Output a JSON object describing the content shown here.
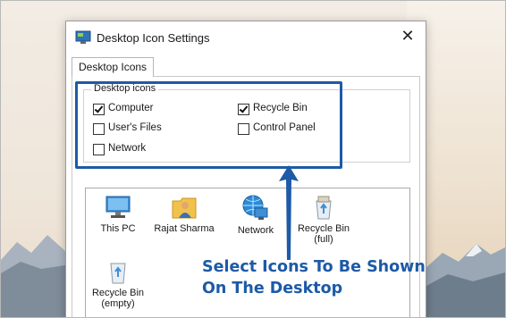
{
  "window": {
    "title": "Desktop Icon Settings",
    "close_symbol": "✕"
  },
  "tabs": [
    {
      "label": "Desktop Icons"
    }
  ],
  "desktop_icons_group": {
    "legend": "Desktop icons",
    "options": [
      {
        "label": "Computer",
        "checked": true
      },
      {
        "label": "Recycle Bin",
        "checked": true
      },
      {
        "label": "User's Files",
        "checked": false
      },
      {
        "label": "Control Panel",
        "checked": false
      },
      {
        "label": "Network",
        "checked": false
      }
    ]
  },
  "icon_list": [
    {
      "label": "This PC",
      "icon": "computer-icon"
    },
    {
      "label": "Rajat Sharma",
      "icon": "user-folder-icon"
    },
    {
      "label": "Network",
      "icon": "network-icon"
    },
    {
      "label": "Recycle Bin (full)",
      "line1": "Recycle Bin",
      "line2": "(full)",
      "icon": "recycle-bin-full-icon"
    },
    {
      "label": "Recycle Bin (empty)",
      "line1": "Recycle Bin",
      "line2": "(empty)",
      "icon": "recycle-bin-empty-icon"
    }
  ],
  "annotation": {
    "line1": "Select Icons To Be Shown",
    "line2": "On The Desktop",
    "color": "#1d5aa7"
  }
}
